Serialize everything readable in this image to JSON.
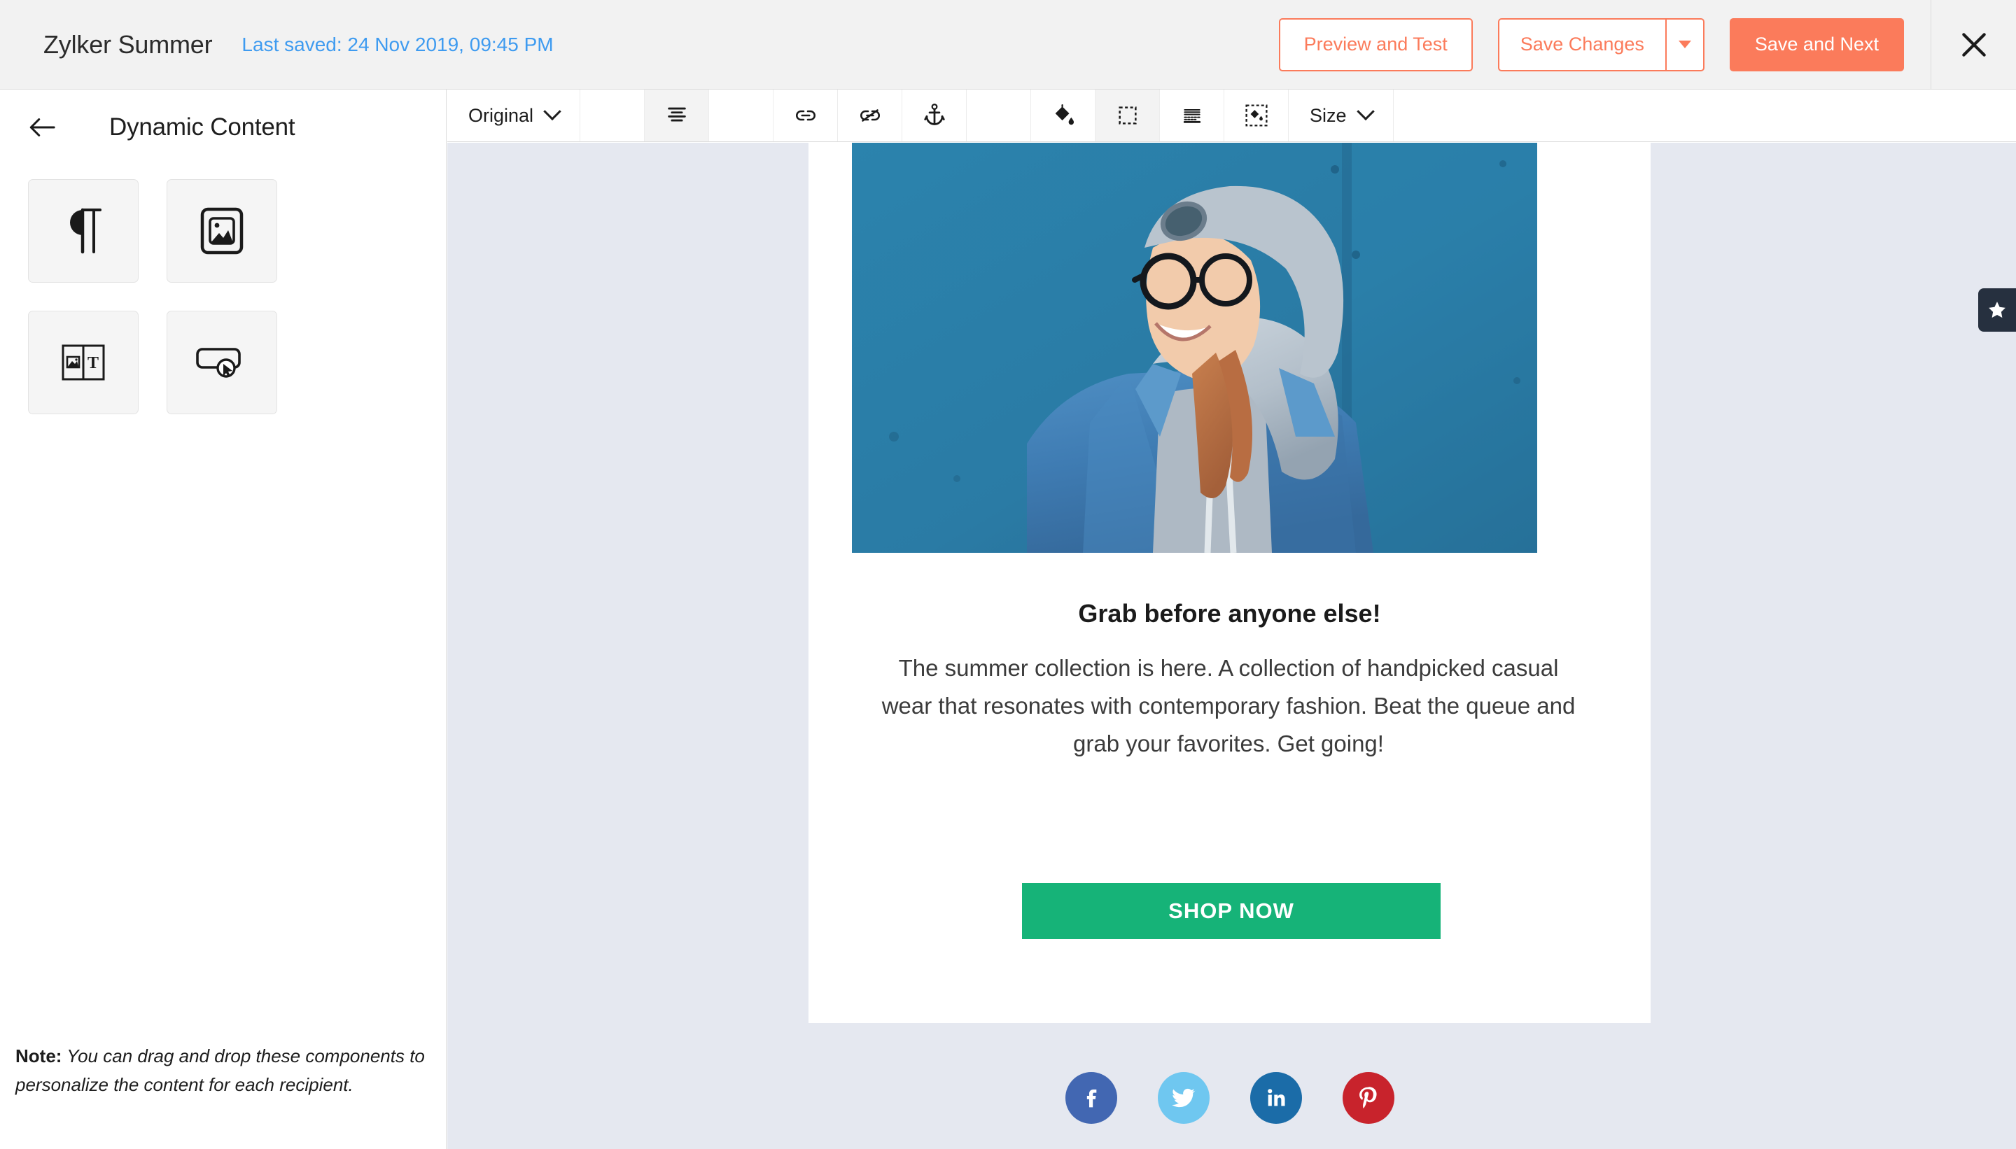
{
  "topbar": {
    "campaign_title": "Zylker Summer",
    "last_saved": "Last saved: 24 Nov 2019, 09:45 PM",
    "preview_and_test": "Preview and Test",
    "save_changes": "Save Changes",
    "save_and_next": "Save and Next",
    "accent_color": "#fb7b5b",
    "link_color": "#3e9bf0"
  },
  "sidebar": {
    "title": "Dynamic Content",
    "back_icon": "arrow-left-icon",
    "tiles": [
      {
        "name": "text-component",
        "icon": "paragraph-icon"
      },
      {
        "name": "image-component",
        "icon": "image-icon"
      },
      {
        "name": "image-and-text-component",
        "icon": "image-text-icon"
      },
      {
        "name": "button-component",
        "icon": "button-click-icon"
      }
    ],
    "note_label": "Note:",
    "note_text": " You can drag and drop these components to personalize the content for each recipient."
  },
  "toolbar": {
    "style_dropdown": "Original",
    "size_dropdown": "Size",
    "items": [
      {
        "name": "align-center-button",
        "icon": "align-center-icon",
        "active": true
      },
      {
        "name": "insert-link-button",
        "icon": "link-icon",
        "active": false
      },
      {
        "name": "remove-link-button",
        "icon": "unlink-icon",
        "active": false
      },
      {
        "name": "anchor-button",
        "icon": "anchor-icon",
        "active": false
      },
      {
        "name": "fill-color-button",
        "icon": "paint-bucket-icon",
        "active": false
      },
      {
        "name": "border-button",
        "icon": "dashed-box-icon",
        "active": false
      },
      {
        "name": "padding-button",
        "icon": "line-rows-icon",
        "active": false
      },
      {
        "name": "background-color-button",
        "icon": "paint-bucket-box-icon",
        "active": false
      }
    ]
  },
  "email": {
    "hero_alt": "woman in denim jacket and grey hoodie against blue wall",
    "heading": "Grab before anyone else!",
    "body": "The summer collection is here. A collection of handpicked casual wear that resonates with contemporary fashion. Beat the queue and grab your favorites. Get going!",
    "cta_label": "SHOP NOW",
    "cta_color": "#16b378",
    "canvas_color": "#e5e8f0",
    "social": [
      {
        "name": "facebook-icon",
        "label": "f",
        "color": "#4267b2"
      },
      {
        "name": "twitter-icon",
        "label": "t",
        "color": "#6fc7f0"
      },
      {
        "name": "linkedin-icon",
        "label": "in",
        "color": "#1b6ca8"
      },
      {
        "name": "pinterest-icon",
        "label": "p",
        "color": "#c8232c"
      }
    ]
  },
  "star_badge": {
    "icon": "star-icon",
    "color": "#26303f"
  }
}
